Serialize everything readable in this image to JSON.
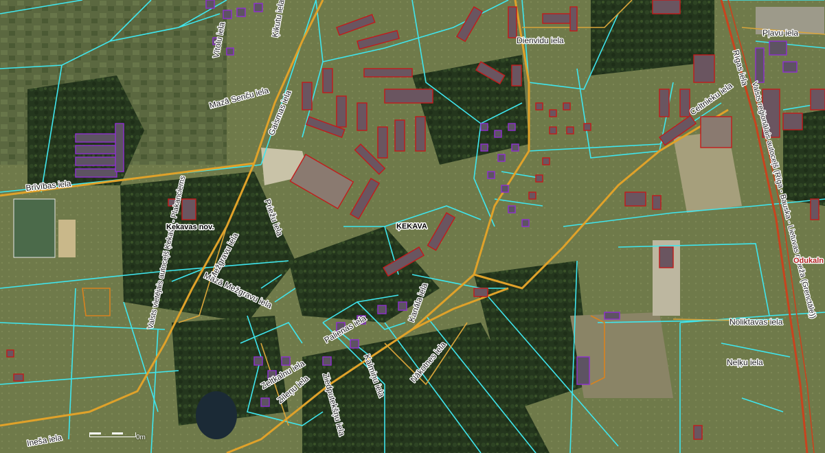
{
  "map": {
    "labels": {
      "brivibas": "Brīvības iela",
      "mazasencu": "Mazā Senču iela",
      "gaismas": "Gaismas iela",
      "vitolu": "Vītolu iela",
      "kikutu": "Ķikutu iela",
      "dienvidu": "Dienvidu iela",
      "plavu": "Pļavu iela",
      "rigas": "Rīgas iela",
      "celtnieku": "Celtnieku iela",
      "valsts_reg": "Valsts reģionālais autoceļš (Rīga - Bauska - Lietuvas robeža (Grenctāle))",
      "valsts_viet": "Valsts vietējais autoceļš Ķekava - Plakanciems",
      "priezu": "Priežu iela",
      "meza": "Mežgravu iela",
      "mazamezg": "Mazā Mežgravu iela",
      "kekavasnov": "Ķekavas nov.",
      "kekava": "ĶEKAVA",
      "kanala": "Kanāla iela",
      "palienas": "Palienas iela",
      "kalnina": "Kalmiņu iela",
      "zeltaliela": "Zeltkalnu iela",
      "zilenu": "Zīleņu iela",
      "ziedputeksnu": "Ziedputekšņu iela",
      "nakotnes": "Nākotnes iela",
      "noliktavas": "Noliktavas iela",
      "nelku": "Neļķu iela",
      "odukalns": "Odukaln",
      "imesu": "Ineša iela"
    },
    "scale": {
      "label": "0m"
    },
    "colors": {
      "parcel": "#3fe6ee",
      "road": "#e0a22a",
      "highway": "#c9431e",
      "building_red": "#c21b1b",
      "building_purple": "#8e2fd0"
    }
  }
}
